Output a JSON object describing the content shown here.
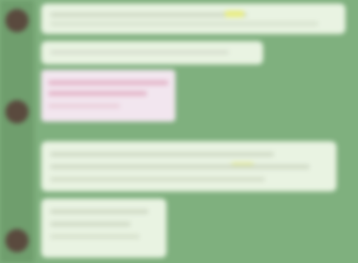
{
  "window": {
    "title": ""
  },
  "sidebar": {
    "avatars": [
      {
        "label": ""
      },
      {
        "label": ""
      },
      {
        "label": ""
      }
    ]
  },
  "chat": {
    "messages": [
      {
        "text": ""
      },
      {
        "text": ""
      },
      {
        "text": ""
      },
      {
        "text": ""
      }
    ]
  }
}
